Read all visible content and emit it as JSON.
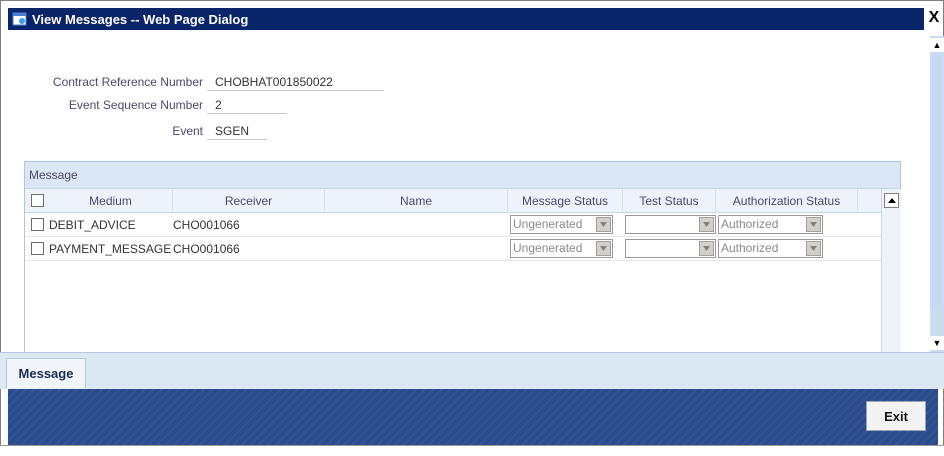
{
  "window": {
    "title": "View Messages -- Web Page Dialog",
    "close_glyph": "X",
    "icon": "ie-page-icon"
  },
  "fields": {
    "contract_ref_label": "Contract Reference Number",
    "contract_ref_value": "CHOBHAT001850022",
    "event_seq_label": "Event Sequence Number",
    "event_seq_value": "2",
    "event_label": "Event",
    "event_value": "SGEN"
  },
  "message_panel": {
    "header": "Message",
    "columns": [
      "Medium",
      "Receiver",
      "Name",
      "Message Status",
      "Test Status",
      "Authorization Status"
    ],
    "rows": [
      {
        "medium": "DEBIT_ADVICE",
        "receiver": "CHO001066",
        "name": "",
        "message_status": "Ungenerated",
        "test_status": "",
        "authorization_status": "Authorized"
      },
      {
        "medium": "PAYMENT_MESSAGE",
        "receiver": "CHO001066",
        "name": "",
        "message_status": "Ungenerated",
        "test_status": "",
        "authorization_status": "Authorized"
      }
    ]
  },
  "tabs": {
    "message": "Message"
  },
  "footer": {
    "exit_label": "Exit"
  },
  "colors": {
    "titlebar": "#0a246a",
    "footer": "#2a4b8c",
    "panel_header": "#dbe7f4"
  }
}
